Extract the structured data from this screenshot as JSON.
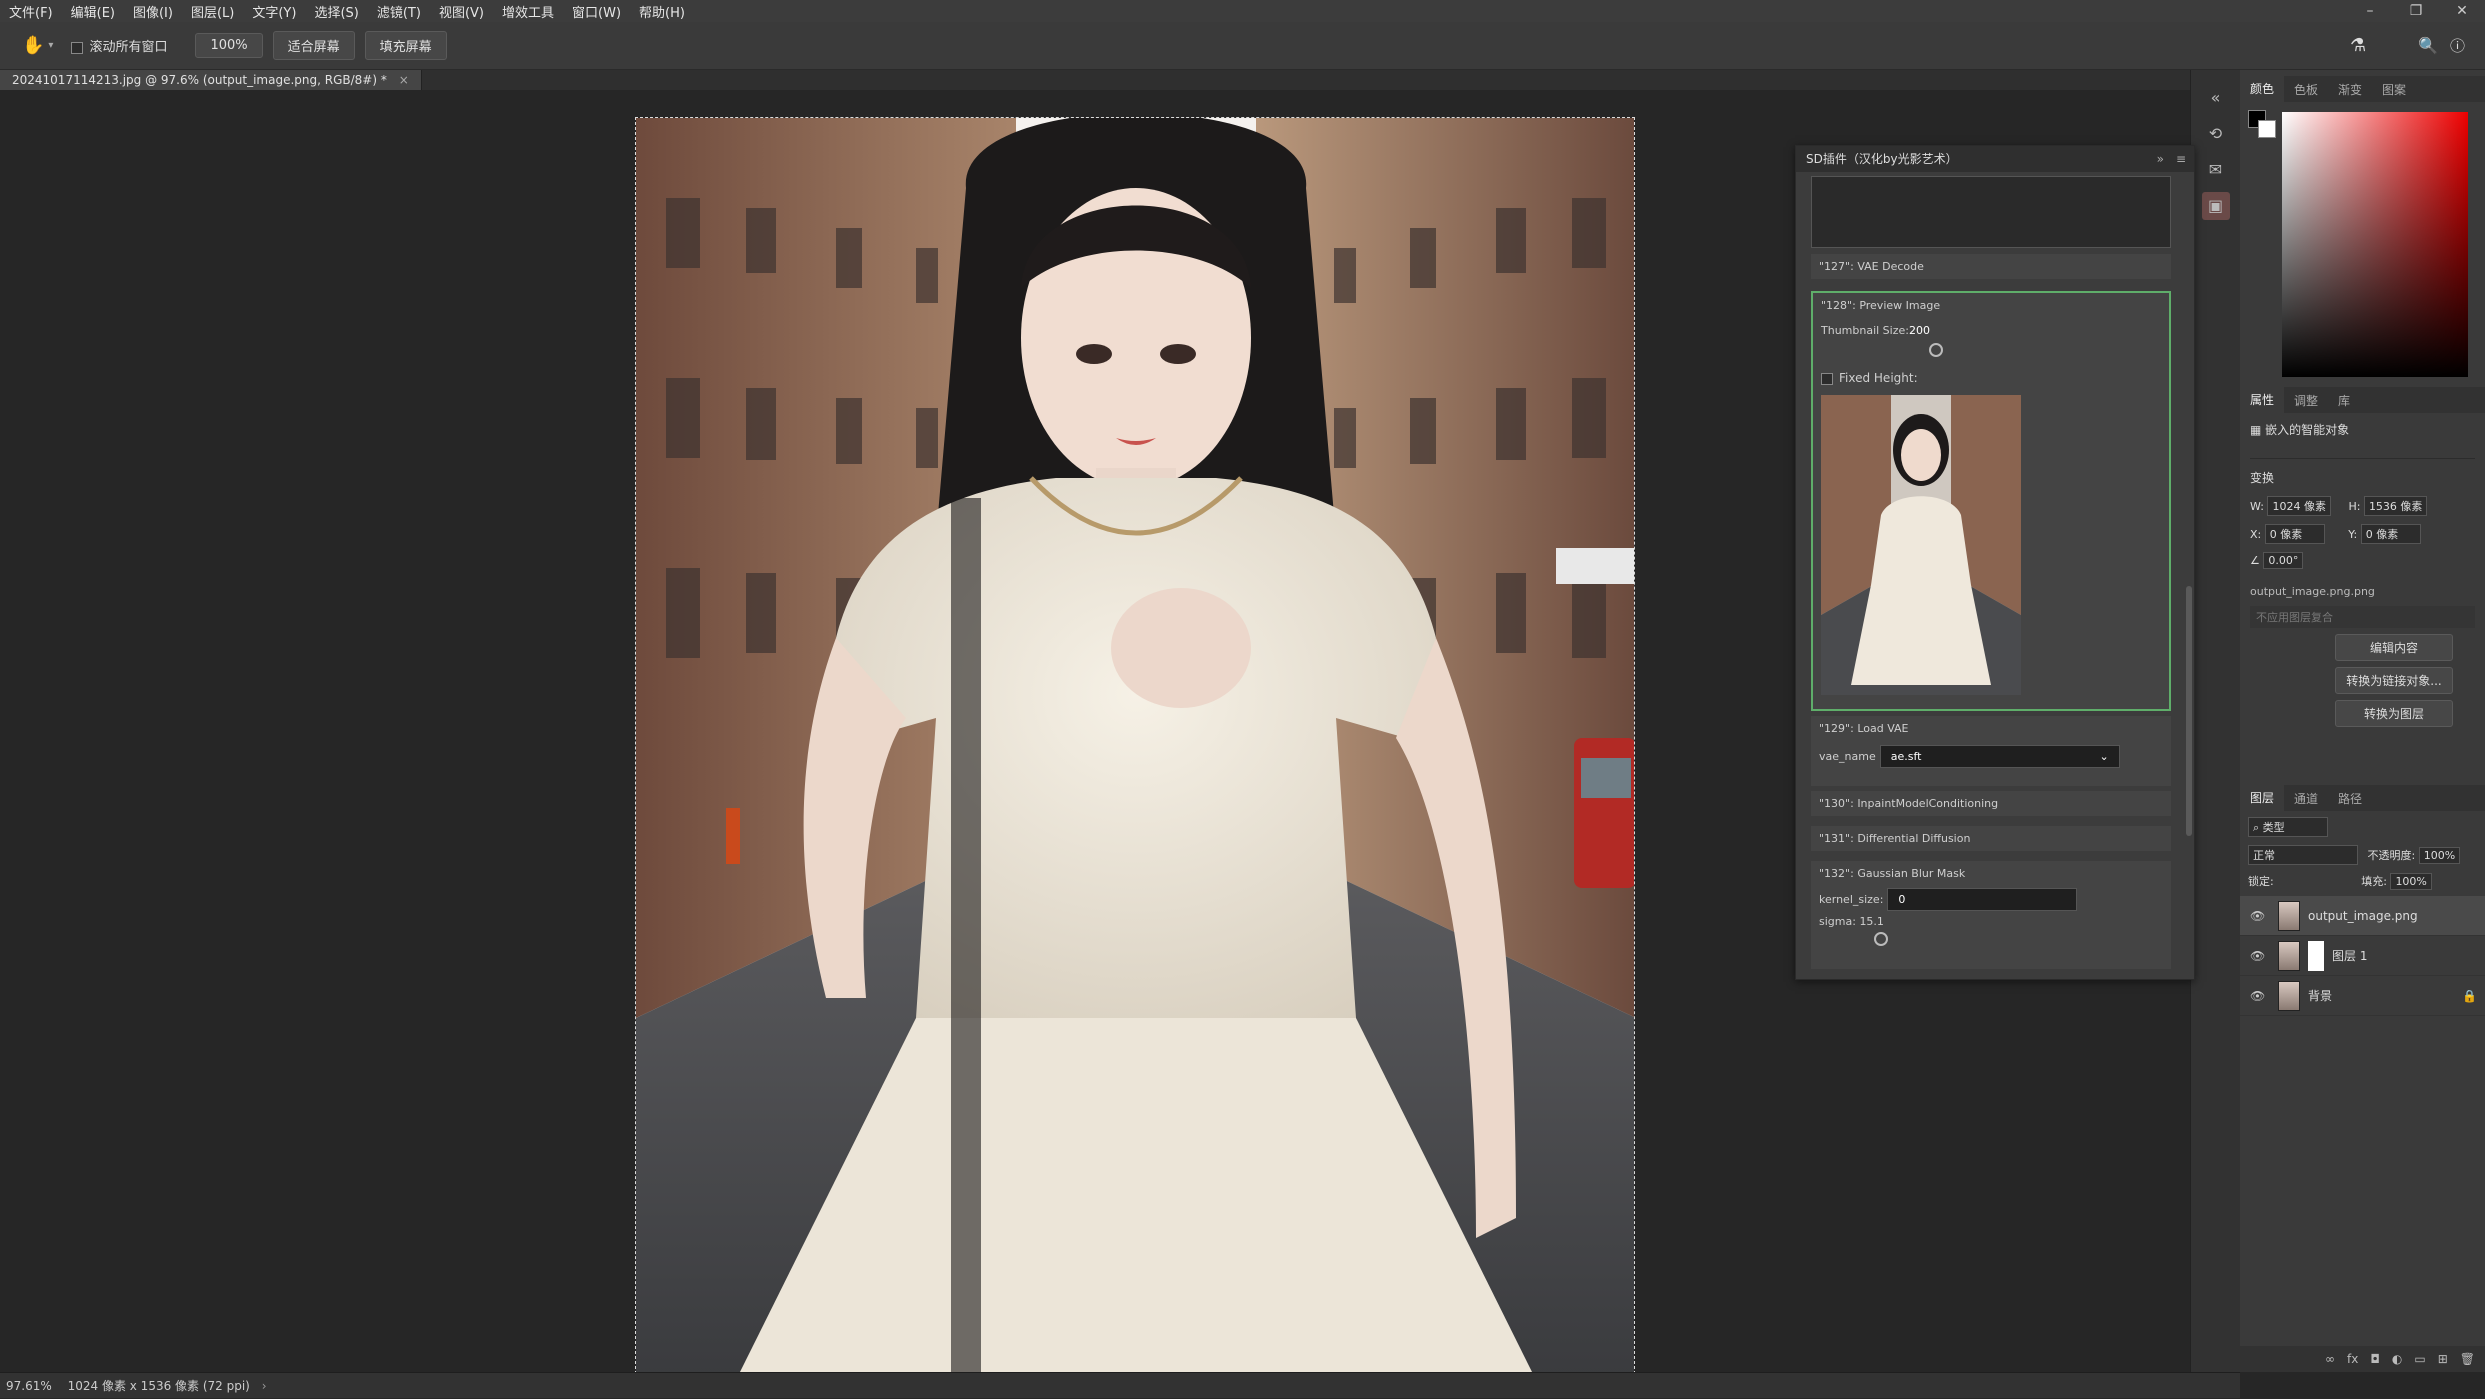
{
  "menubar": {
    "items": [
      "文件(F)",
      "编辑(E)",
      "图像(I)",
      "图层(L)",
      "文字(Y)",
      "选择(S)",
      "滤镜(T)",
      "视图(V)",
      "增效工具",
      "窗口(W)",
      "帮助(H)"
    ]
  },
  "optbar": {
    "scroll_all_label": "滚动所有窗口",
    "zoom": "100%",
    "fit_screen": "适合屏幕",
    "fill_screen": "填充屏幕"
  },
  "document": {
    "tab_title": "20241017114213.jpg @ 97.6% (output_image.png, RGB/8#) *"
  },
  "status": {
    "zoom": "97.61%",
    "info": "1024 像素 x 1536 像素 (72 ppi)"
  },
  "sd_panel": {
    "title": "SD插件（汉化by光影艺术）",
    "node_127": "\"127\": VAE Decode",
    "node_128": "\"128\": Preview Image",
    "thumb_size_label": "Thumbnail Size:",
    "thumb_size_value": "200",
    "fixed_height": "Fixed Height:",
    "node_129": "\"129\": Load VAE",
    "vae_label": "vae_name",
    "vae_value": "ae.sft",
    "node_130": "\"130\": InpaintModelConditioning",
    "node_131": "\"131\": Differential Diffusion",
    "node_132": "\"132\": Gaussian Blur Mask",
    "kernel_label": "kernel_size:",
    "kernel_value": "0",
    "sigma_label": "sigma:",
    "sigma_value": "15.1"
  },
  "color_panel": {
    "tabs": [
      "颜色",
      "色板",
      "渐变",
      "图案"
    ]
  },
  "props_panel": {
    "tabs": [
      "属性",
      "调整",
      "库"
    ],
    "object_type": "嵌入的智能对象",
    "transform": "变换",
    "w_label": "W:",
    "w_value": "1024 像素",
    "h_label": "H:",
    "h_value": "1536 像素",
    "x_label": "X:",
    "x_value": "0 像素",
    "y_label": "Y:",
    "y_value": "0 像素",
    "angle": "0.00°",
    "filename": "output_image.png.png",
    "comp_placeholder": "不应用图层复合",
    "btn_edit": "编辑内容",
    "btn_link": "转换为链接对象...",
    "btn_layer": "转换为图层"
  },
  "layers_panel": {
    "tabs": [
      "图层",
      "通道",
      "路径"
    ],
    "filter": "类型",
    "blend": "正常",
    "opacity_label": "不透明度:",
    "opacity": "100%",
    "lock_label": "锁定:",
    "fill_label": "填充:",
    "fill": "100%",
    "layers": [
      "output_image.png",
      "图层 1",
      "背景"
    ]
  }
}
